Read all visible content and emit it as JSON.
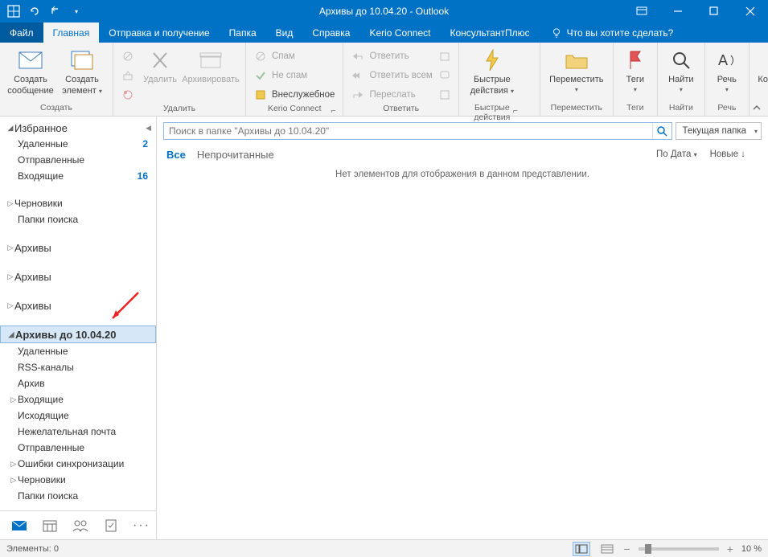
{
  "titlebar": {
    "title": "Архивы до 10.04.20  -  Outlook"
  },
  "tabs": {
    "file": "Файл",
    "home": "Главная",
    "sendreceive": "Отправка и получение",
    "folder": "Папка",
    "view": "Вид",
    "help": "Справка",
    "kerio": "Kerio Connect",
    "consultant": "КонсультантПлюс",
    "tellme": "Что вы хотите сделать?"
  },
  "ribbon": {
    "new_msg_l1": "Создать",
    "new_msg_l2": "сообщение",
    "new_item_l1": "Создать",
    "new_item_l2": "элемент",
    "g_create": "Создать",
    "delete": "Удалить",
    "archive": "Архивировать",
    "g_delete": "Удалить",
    "spam": "Спам",
    "not_spam": "Не спам",
    "non_business": "Внеслужебное",
    "g_kerio": "Kerio Connect",
    "reply": "Ответить",
    "reply_all": "Ответить всем",
    "forward": "Переслать",
    "g_reply": "Ответить",
    "quick_l1": "Быстрые",
    "quick_l2": "действия",
    "g_quick": "Быстрые действия",
    "move": "Переместить",
    "g_move": "Переместить",
    "tags": "Теги",
    "g_tags": "Теги",
    "find": "Найти",
    "g_find": "Найти",
    "speech": "Речь",
    "g_speech": "Речь",
    "consultant": "КонсультантПлюс",
    "g_consultant": ""
  },
  "sidebar": {
    "favorites": "Избранное",
    "deleted": "Удаленные",
    "deleted_count": "2",
    "sent": "Отправленные",
    "inbox": "Входящие",
    "inbox_count": "16",
    "drafts": "Черновики",
    "search_folders": "Папки поиска",
    "archives": "Архивы",
    "archives_selected": "Архивы до 10.04.20",
    "sub_deleted": "Удаленные",
    "sub_rss": "RSS-каналы",
    "sub_archive": "Архив",
    "sub_inbox": "Входящие",
    "sub_outbox": "Исходящие",
    "sub_junk": "Нежелательная почта",
    "sub_sent": "Отправленные",
    "sub_syncerr": "Ошибки синхронизации",
    "sub_drafts": "Черновики",
    "sub_search": "Папки поиска"
  },
  "search": {
    "placeholder": "Поиск в папке \"Архивы до 10.04.20\"",
    "scope": "Текущая папка"
  },
  "filters": {
    "all": "Все",
    "unread": "Непрочитанные",
    "sort": "По Дата",
    "newest": "Новые ↓"
  },
  "empty": "Нет элементов для отображения в данном представлении.",
  "status": {
    "items": "Элементы: 0",
    "zoom": "10 %"
  }
}
